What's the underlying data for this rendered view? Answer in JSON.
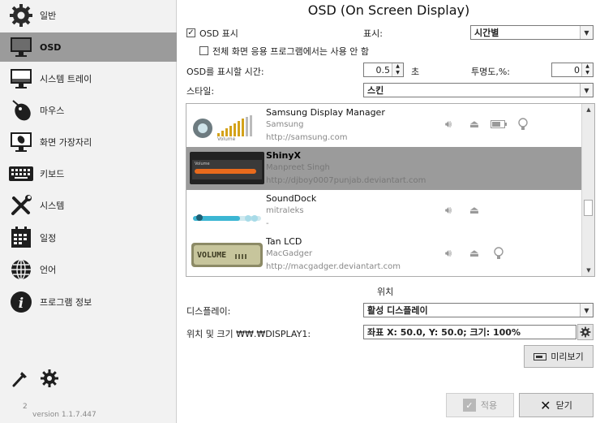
{
  "sidebar": {
    "items": [
      {
        "label": "일반",
        "icon": "gear-icon"
      },
      {
        "label": "OSD",
        "icon": "monitor-icon"
      },
      {
        "label": "시스템 트레이",
        "icon": "system-tray-icon"
      },
      {
        "label": "마우스",
        "icon": "mouse-icon"
      },
      {
        "label": "화면 가장자리",
        "icon": "screen-edge-icon"
      },
      {
        "label": "키보드",
        "icon": "keyboard-icon"
      },
      {
        "label": "시스템",
        "icon": "tools-icon"
      },
      {
        "label": "일정",
        "icon": "calendar-icon"
      },
      {
        "label": "언어",
        "icon": "globe-icon"
      },
      {
        "label": "프로그램 정보",
        "icon": "info-icon"
      }
    ],
    "active_index": 1,
    "version_badge": "2",
    "version": "version 1.1.7.447"
  },
  "main": {
    "title": "OSD (On Screen Display)",
    "osd_show_label": "OSD 표시",
    "osd_show_checked": true,
    "display_label": "표시:",
    "display_value": "시간별",
    "fullscreen_label": "전체 화면 응용 프로그램에서는 사용 안 함",
    "fullscreen_checked": false,
    "duration_label": "OSD를 표시할 시간:",
    "duration_value": "0.5",
    "duration_unit": "초",
    "opacity_label": "투명도,%:",
    "opacity_value": "0",
    "style_label": "스타일:",
    "style_value": "스킨",
    "skins": [
      {
        "name": "Samsung Display Manager",
        "author": "Samsung",
        "url": "http://samsung.com",
        "features": [
          "volume-icon",
          "eject-icon",
          "battery-icon",
          "bulb-icon"
        ]
      },
      {
        "name": "ShinyX",
        "author": "Manpreet Singh",
        "url": "http://djboy0007punjab.deviantart.com",
        "features": []
      },
      {
        "name": "SoundDock",
        "author": "mitraleks",
        "url": "-",
        "features": [
          "volume-icon",
          "eject-icon"
        ]
      },
      {
        "name": "Tan LCD",
        "author": "MacGadger",
        "url": "http://macgadger.deviantart.com",
        "features": [
          "volume-icon",
          "eject-icon",
          "bulb-icon"
        ]
      }
    ],
    "selected_skin": 1,
    "position_heading": "위치",
    "display_select_label": "디스플레이:",
    "display_select_value": "활성 디스플레이",
    "pos_size_label": "위치 및 크기 ₩₩.₩DISPLAY1:",
    "pos_size_value": "좌표 X: 50.0, Y: 50.0; 크기: 100%",
    "preview_label": "미리보기",
    "apply_label": "적용",
    "close_label": "닫기"
  },
  "colors": {
    "active_nav": "#9b9b9b",
    "selected_skin": "#9b9b9b",
    "accent_orange": "#e86a1c"
  }
}
